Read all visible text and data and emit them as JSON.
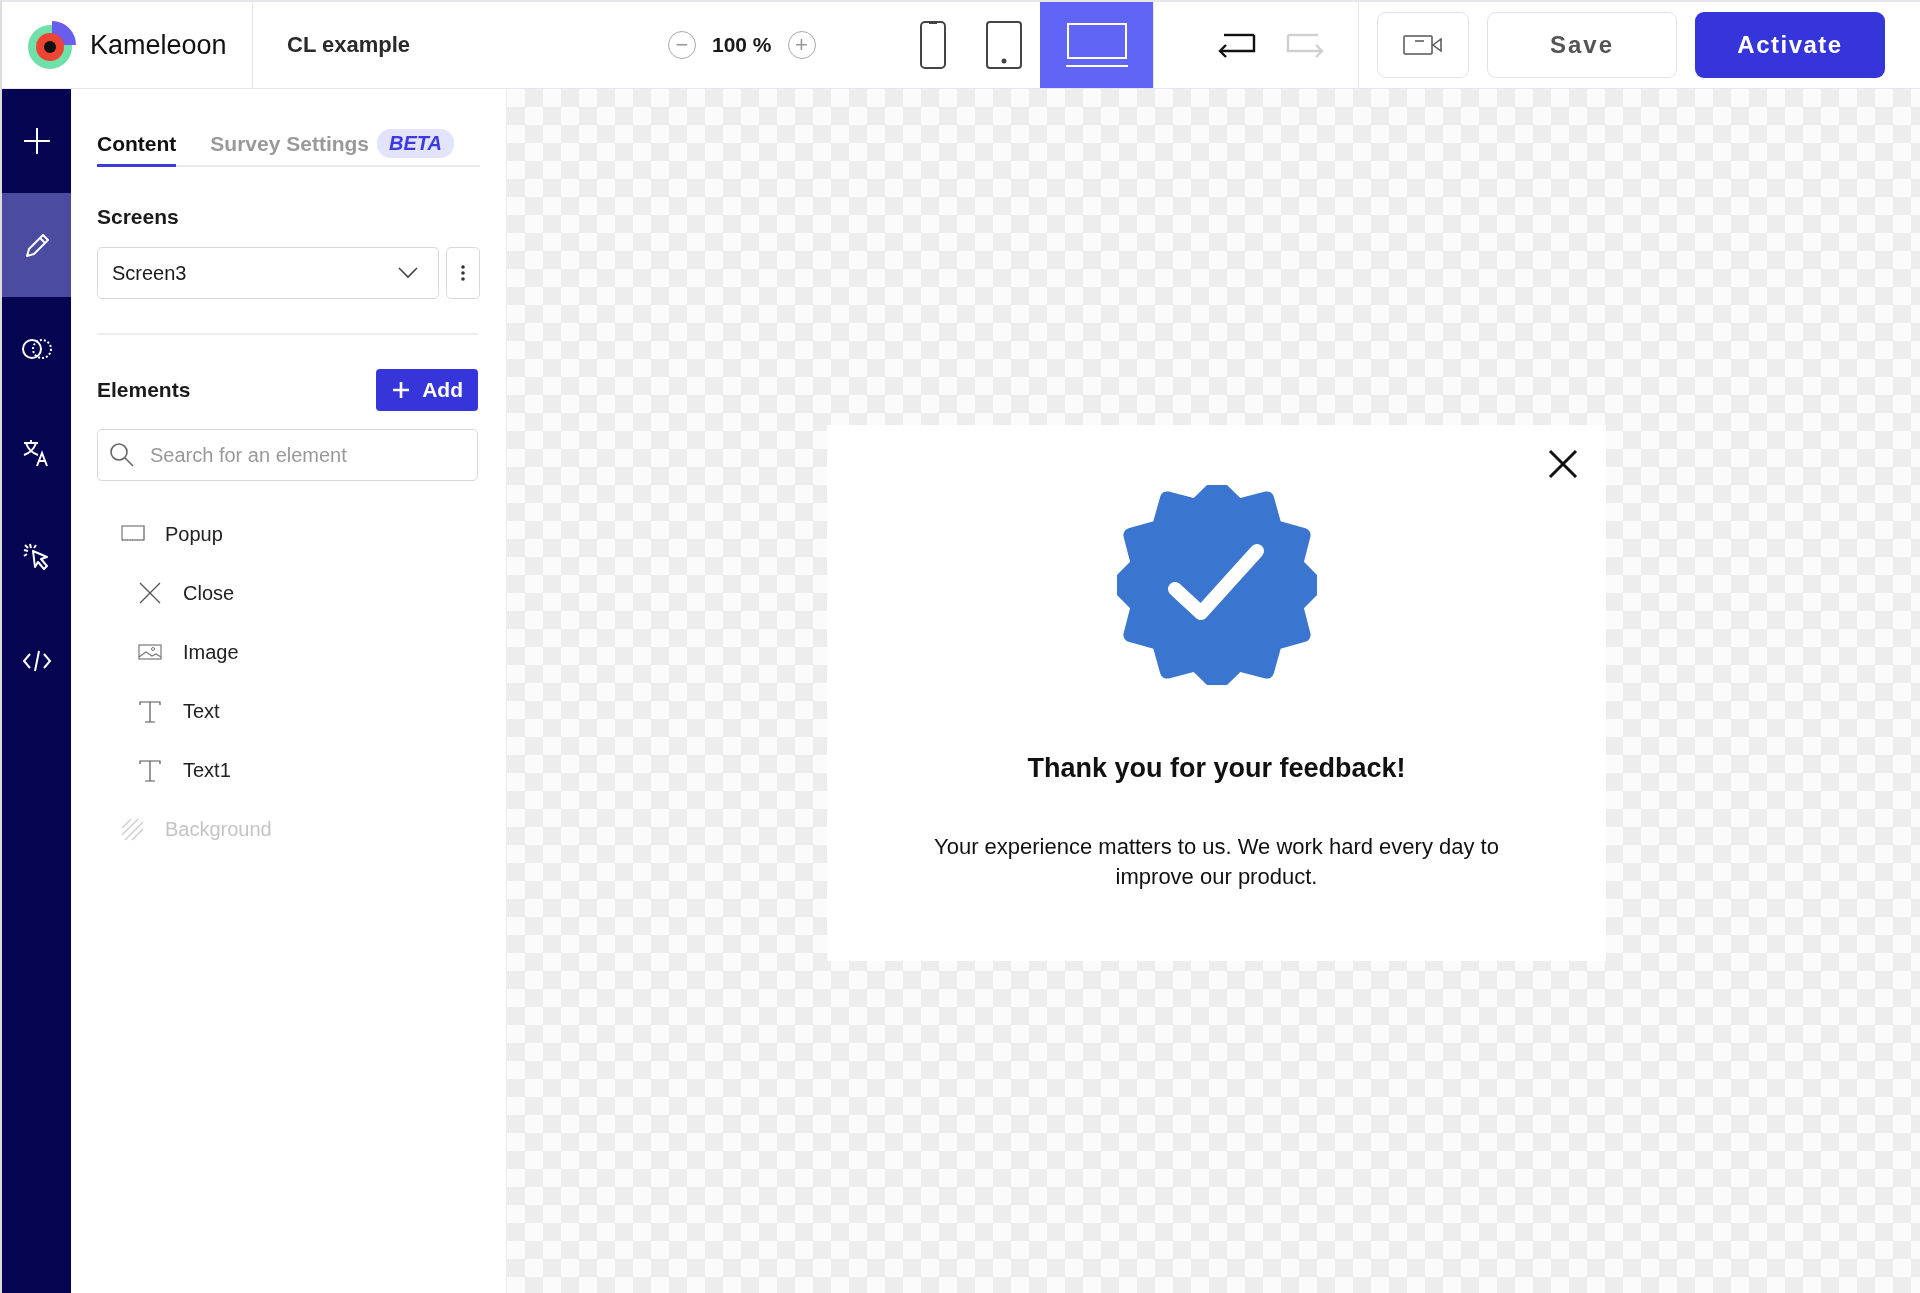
{
  "topbar": {
    "brand": "Kameleoon",
    "project_title": "CL example",
    "zoom": {
      "minus": "−",
      "value": "100 %",
      "plus": "+"
    },
    "devices": [
      {
        "kind": "phone",
        "selected": false
      },
      {
        "kind": "tablet",
        "selected": false
      },
      {
        "kind": "desktop",
        "selected": true
      }
    ],
    "history": [
      {
        "kind": "undo",
        "disabled": false
      },
      {
        "kind": "redo",
        "disabled": true
      }
    ],
    "save_button": "Save",
    "activate_button": "Activate"
  },
  "rail": [
    {
      "kind": "add",
      "selected": false
    },
    {
      "kind": "edit",
      "selected": true
    },
    {
      "kind": "segments",
      "selected": false
    },
    {
      "kind": "translate",
      "selected": false
    },
    {
      "kind": "interaction",
      "selected": false
    },
    {
      "kind": "code",
      "selected": false
    }
  ],
  "panel": {
    "tabs": [
      {
        "label": "Content",
        "selected": true
      },
      {
        "label": "Survey Settings",
        "badge": "BETA",
        "selected": false
      }
    ],
    "screens": {
      "heading": "Screens",
      "value": "Screen3"
    },
    "elements": {
      "heading": "Elements",
      "add_button": "Add",
      "search": {
        "placeholder": "Search for an element"
      },
      "tree": [
        {
          "label": "Popup",
          "kind": "popup",
          "disabled": false,
          "children": [
            {
              "label": "Close",
              "kind": "close",
              "disabled": false
            },
            {
              "label": "Image",
              "kind": "image",
              "disabled": false
            },
            {
              "label": "Text",
              "kind": "text",
              "disabled": false
            },
            {
              "label": "Text1",
              "kind": "text",
              "disabled": false
            }
          ]
        },
        {
          "label": "Background",
          "kind": "background",
          "disabled": true
        }
      ]
    }
  },
  "preview": {
    "popup": {
      "title": "Thank you for your feedback!",
      "body": "Your experience matters to us. We work hard every day to improve our product."
    }
  }
}
